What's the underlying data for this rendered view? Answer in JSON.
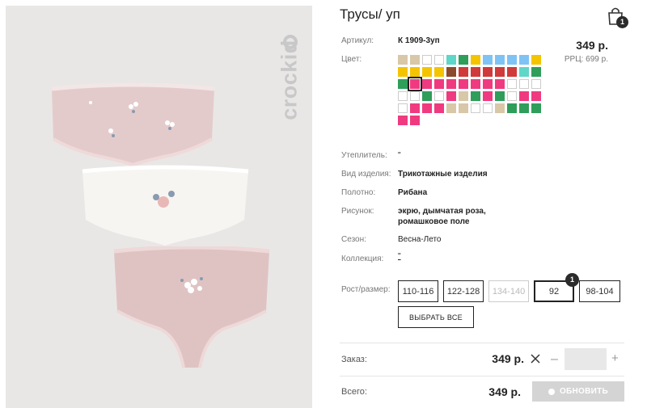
{
  "product": {
    "title": "Трусы/ уп",
    "brand": "crockid",
    "price": "349 р.",
    "rrp": "РРЦ: 699 р."
  },
  "cart": {
    "badge": "1",
    "icon": "shopping-bag-icon"
  },
  "specs": {
    "article_label": "Артикул:",
    "article_value": "К 1909-3уп",
    "color_label": "Цвет:",
    "insulation_label": "Утеплитель:",
    "insulation_value": "\"",
    "type_label": "Вид изделия:",
    "type_value": "Трикотажные изделия",
    "fabric_label": "Полотно:",
    "fabric_value": "Рибана",
    "pattern_label": "Рисунок:",
    "pattern_value_1": "экрю, дымчатая роза,",
    "pattern_value_2": "ромашковое поле",
    "season_label": "Сезон:",
    "season_value": "Весна-Лето",
    "collection_label": "Коллекция:",
    "collection_value": "\""
  },
  "swatches": [
    "#d8c8a8",
    "#d8c8a8",
    "#ffffff",
    "#ffffff",
    "#5ed6c8",
    "#2e9e5a",
    "#f5c400",
    "#7fc3f5",
    "#7fc3f5",
    "#7fc3f5",
    "#7fc3f5",
    "#f5c400",
    "#f5c400",
    "#f5c400",
    "#f5c400",
    "#f5c400",
    "#8b4a2b",
    "#d03a3a",
    "#d03a3a",
    "#d03a3a",
    "#d03a3a",
    "#d03a3a",
    "#5ed6c8",
    "#2e9e5a",
    "#2e9e5a",
    "#f03a80",
    "#f03a80",
    "#f03a80",
    "#f03a80",
    "#f03a80",
    "#f03a80",
    "#f03a80",
    "#f03a80",
    "#ffffff",
    "#ffffff",
    "#ffffff",
    "#ffffff",
    "#ffffff",
    "#2e9e5a",
    "#ffffff",
    "#f03a80",
    "#d8c8a8",
    "#2e9e5a",
    "#f03a80",
    "#2e9e5a",
    "#ffffff",
    "#f03a80",
    "#f03a80",
    "#ffffff",
    "#f03a80",
    "#f03a80",
    "#f03a80",
    "#d8c8a8",
    "#d8c8a8",
    "#ffffff",
    "#ffffff",
    "#d8c8a8",
    "#2e9e5a",
    "#2e9e5a",
    "#2e9e5a",
    "#f03a80",
    "#f03a80"
  ],
  "selected_swatch": 25,
  "sizes": {
    "label": "Рост/размер:",
    "items": [
      {
        "label": "110-116",
        "state": "normal"
      },
      {
        "label": "122-128",
        "state": "normal"
      },
      {
        "label": "134-140",
        "state": "disabled"
      },
      {
        "label": "92",
        "state": "selected",
        "badge": "1"
      },
      {
        "label": "98-104",
        "state": "normal"
      }
    ],
    "select_all": "ВЫБРАТЬ ВСЕ"
  },
  "order": {
    "order_label": "Заказ:",
    "order_price": "349 р.",
    "minus": "–",
    "plus": "+",
    "qty": "",
    "total_label": "Всего:",
    "total_price": "349 р.",
    "update_label": "ОБНОВИТЬ"
  }
}
